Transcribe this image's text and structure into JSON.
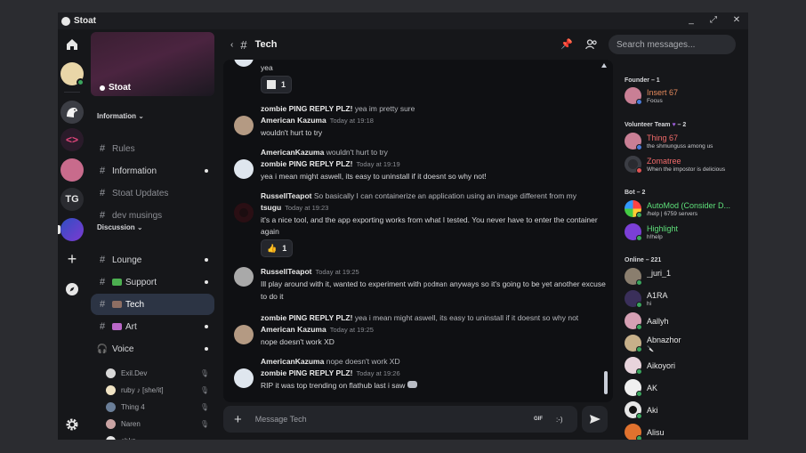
{
  "app": {
    "name": "Stoat"
  },
  "window_controls": {
    "minimize": "_",
    "maximize": "⤢",
    "close": "✕"
  },
  "rail": {
    "servers": [
      {
        "name": "home-icon"
      },
      {
        "name": "user-avatar"
      },
      {
        "name": "stoat-server"
      },
      {
        "name": "code-server"
      },
      {
        "name": "pink-server"
      },
      {
        "name": "tg-server",
        "label": "TG"
      },
      {
        "name": "blue-server"
      }
    ],
    "add_label": "+",
    "settings": "settings"
  },
  "server": {
    "name": "Stoat",
    "categories": [
      {
        "label": "Information",
        "chevron": "⌄"
      },
      {
        "label": "Discussion",
        "chevron": "⌄"
      }
    ],
    "channels": [
      {
        "label": "Rules",
        "unread": false
      },
      {
        "label": "Information",
        "unread": true
      },
      {
        "label": "Stoat Updates",
        "unread": false
      },
      {
        "label": "dev musings",
        "unread": false
      },
      {
        "label": "Lounge",
        "unread": true
      },
      {
        "label": "Support",
        "unread": true
      },
      {
        "label": "Tech",
        "unread": false,
        "active": true
      },
      {
        "label": "Art",
        "unread": true
      },
      {
        "label": "Voice",
        "unread": true
      }
    ],
    "voice_users": [
      "Exil.Dev",
      "ruby ♪ [she/it]",
      "Thing 4",
      "Naren",
      "chkz"
    ]
  },
  "chat": {
    "channel": "Tech",
    "search_placeholder": "Search messages...",
    "composer_placeholder": "Message Tech",
    "gif_label": "GIF",
    "emoji_label": ":-)",
    "messages": [
      {
        "body": "yea",
        "reaction_count": "1"
      },
      {
        "reply_author": "zombie PING REPLY PLZ!",
        "reply_text": "yea im pretty sure",
        "author": "American Kazuma",
        "time": "Today at 19:18",
        "body": "wouldn't hurt to try"
      },
      {
        "reply_author": "AmericanKazuma",
        "reply_text": "wouldn't hurt to try",
        "author": "zombie PING REPLY PLZ!",
        "time": "Today at 19:19",
        "body": "yea i mean might aswell, its easy to uninstall if it doesnt so why not!"
      },
      {
        "reply_author": "RussellTeapot",
        "reply_text": "So basically I can containerize an application using an image different from my",
        "author": "tsugu",
        "time": "Today at 19:23",
        "body": "it's a nice tool, and the app exporting works from what I tested. You never have to enter the container again",
        "reaction_count": "1"
      },
      {
        "author": "RussellTeapot",
        "time": "Today at 19:25",
        "body_pre": "Ill play around with it, wanted to experiment with",
        "body_code": "podman",
        "body_post": "anyways so it's going to be yet another excuse to do it"
      },
      {
        "reply_author": "zombie PING REPLY PLZ!",
        "reply_text": "yea i mean might aswell, its easy to uninstall if it doesnt so why not",
        "author": "American Kazuma",
        "time": "Today at 19:25",
        "body": "nope doesn't work XD"
      },
      {
        "reply_author": "AmericanKazuma",
        "reply_text": "nope doesn't work XD",
        "author": "zombie PING REPLY PLZ!",
        "time": "Today at 19:26",
        "body": "RIP it was top trending on flathub last i saw"
      }
    ]
  },
  "members": {
    "groups": [
      {
        "label": "Founder – 1"
      },
      {
        "label": "Volunteer Team",
        "suffix": "– 2"
      },
      {
        "label": "Bot – 2"
      },
      {
        "label": "Online – 221"
      }
    ],
    "founder": [
      {
        "name": "Insert 67",
        "status": "Focus",
        "color": "#e58a5c"
      }
    ],
    "volunteer": [
      {
        "name": "Thing 67",
        "status": "the shmunguss among us",
        "color": "#f06a6a"
      },
      {
        "name": "Zomatree",
        "status": "When the impostor is delicious",
        "color": "#f06a6a"
      }
    ],
    "bots": [
      {
        "name": "AutoMod (Consider D...",
        "status": "/help | 6759 servers",
        "color": "#5ee07a"
      },
      {
        "name": "Highlight",
        "status": "h!help",
        "color": "#5ee07a"
      }
    ],
    "online": [
      {
        "name": "_juri_1",
        "status": ""
      },
      {
        "name": "A1RA",
        "status": "hi"
      },
      {
        "name": "Aallyh",
        "status": ""
      },
      {
        "name": "Abnazhor",
        "status": "🔪"
      },
      {
        "name": "Aikoyori",
        "status": ""
      },
      {
        "name": "AK",
        "status": ""
      },
      {
        "name": "Aki",
        "status": ""
      },
      {
        "name": "Alisu",
        "status": ""
      }
    ]
  }
}
